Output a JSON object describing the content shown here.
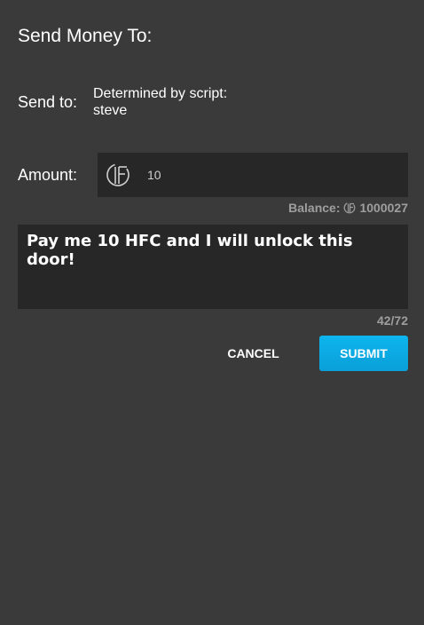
{
  "dialog": {
    "title": "Send Money To:",
    "send_to": {
      "label": "Send to:",
      "value_line1": "Determined by script:",
      "value_line2": "steve"
    },
    "amount": {
      "label": "Amount:",
      "value": "10",
      "currency_icon": "hfc-currency-icon"
    },
    "balance": {
      "label": "Balance:",
      "value": "1000027"
    },
    "message": {
      "value": "Pay me 10 HFC and I will unlock this door!",
      "counter": "42/72"
    },
    "buttons": {
      "cancel": "CANCEL",
      "submit": "SUBMIT"
    },
    "colors": {
      "background": "#3a3a3a",
      "field": "#272727",
      "accent": "#0db5ee",
      "muted_text": "#9e9e9e"
    }
  }
}
